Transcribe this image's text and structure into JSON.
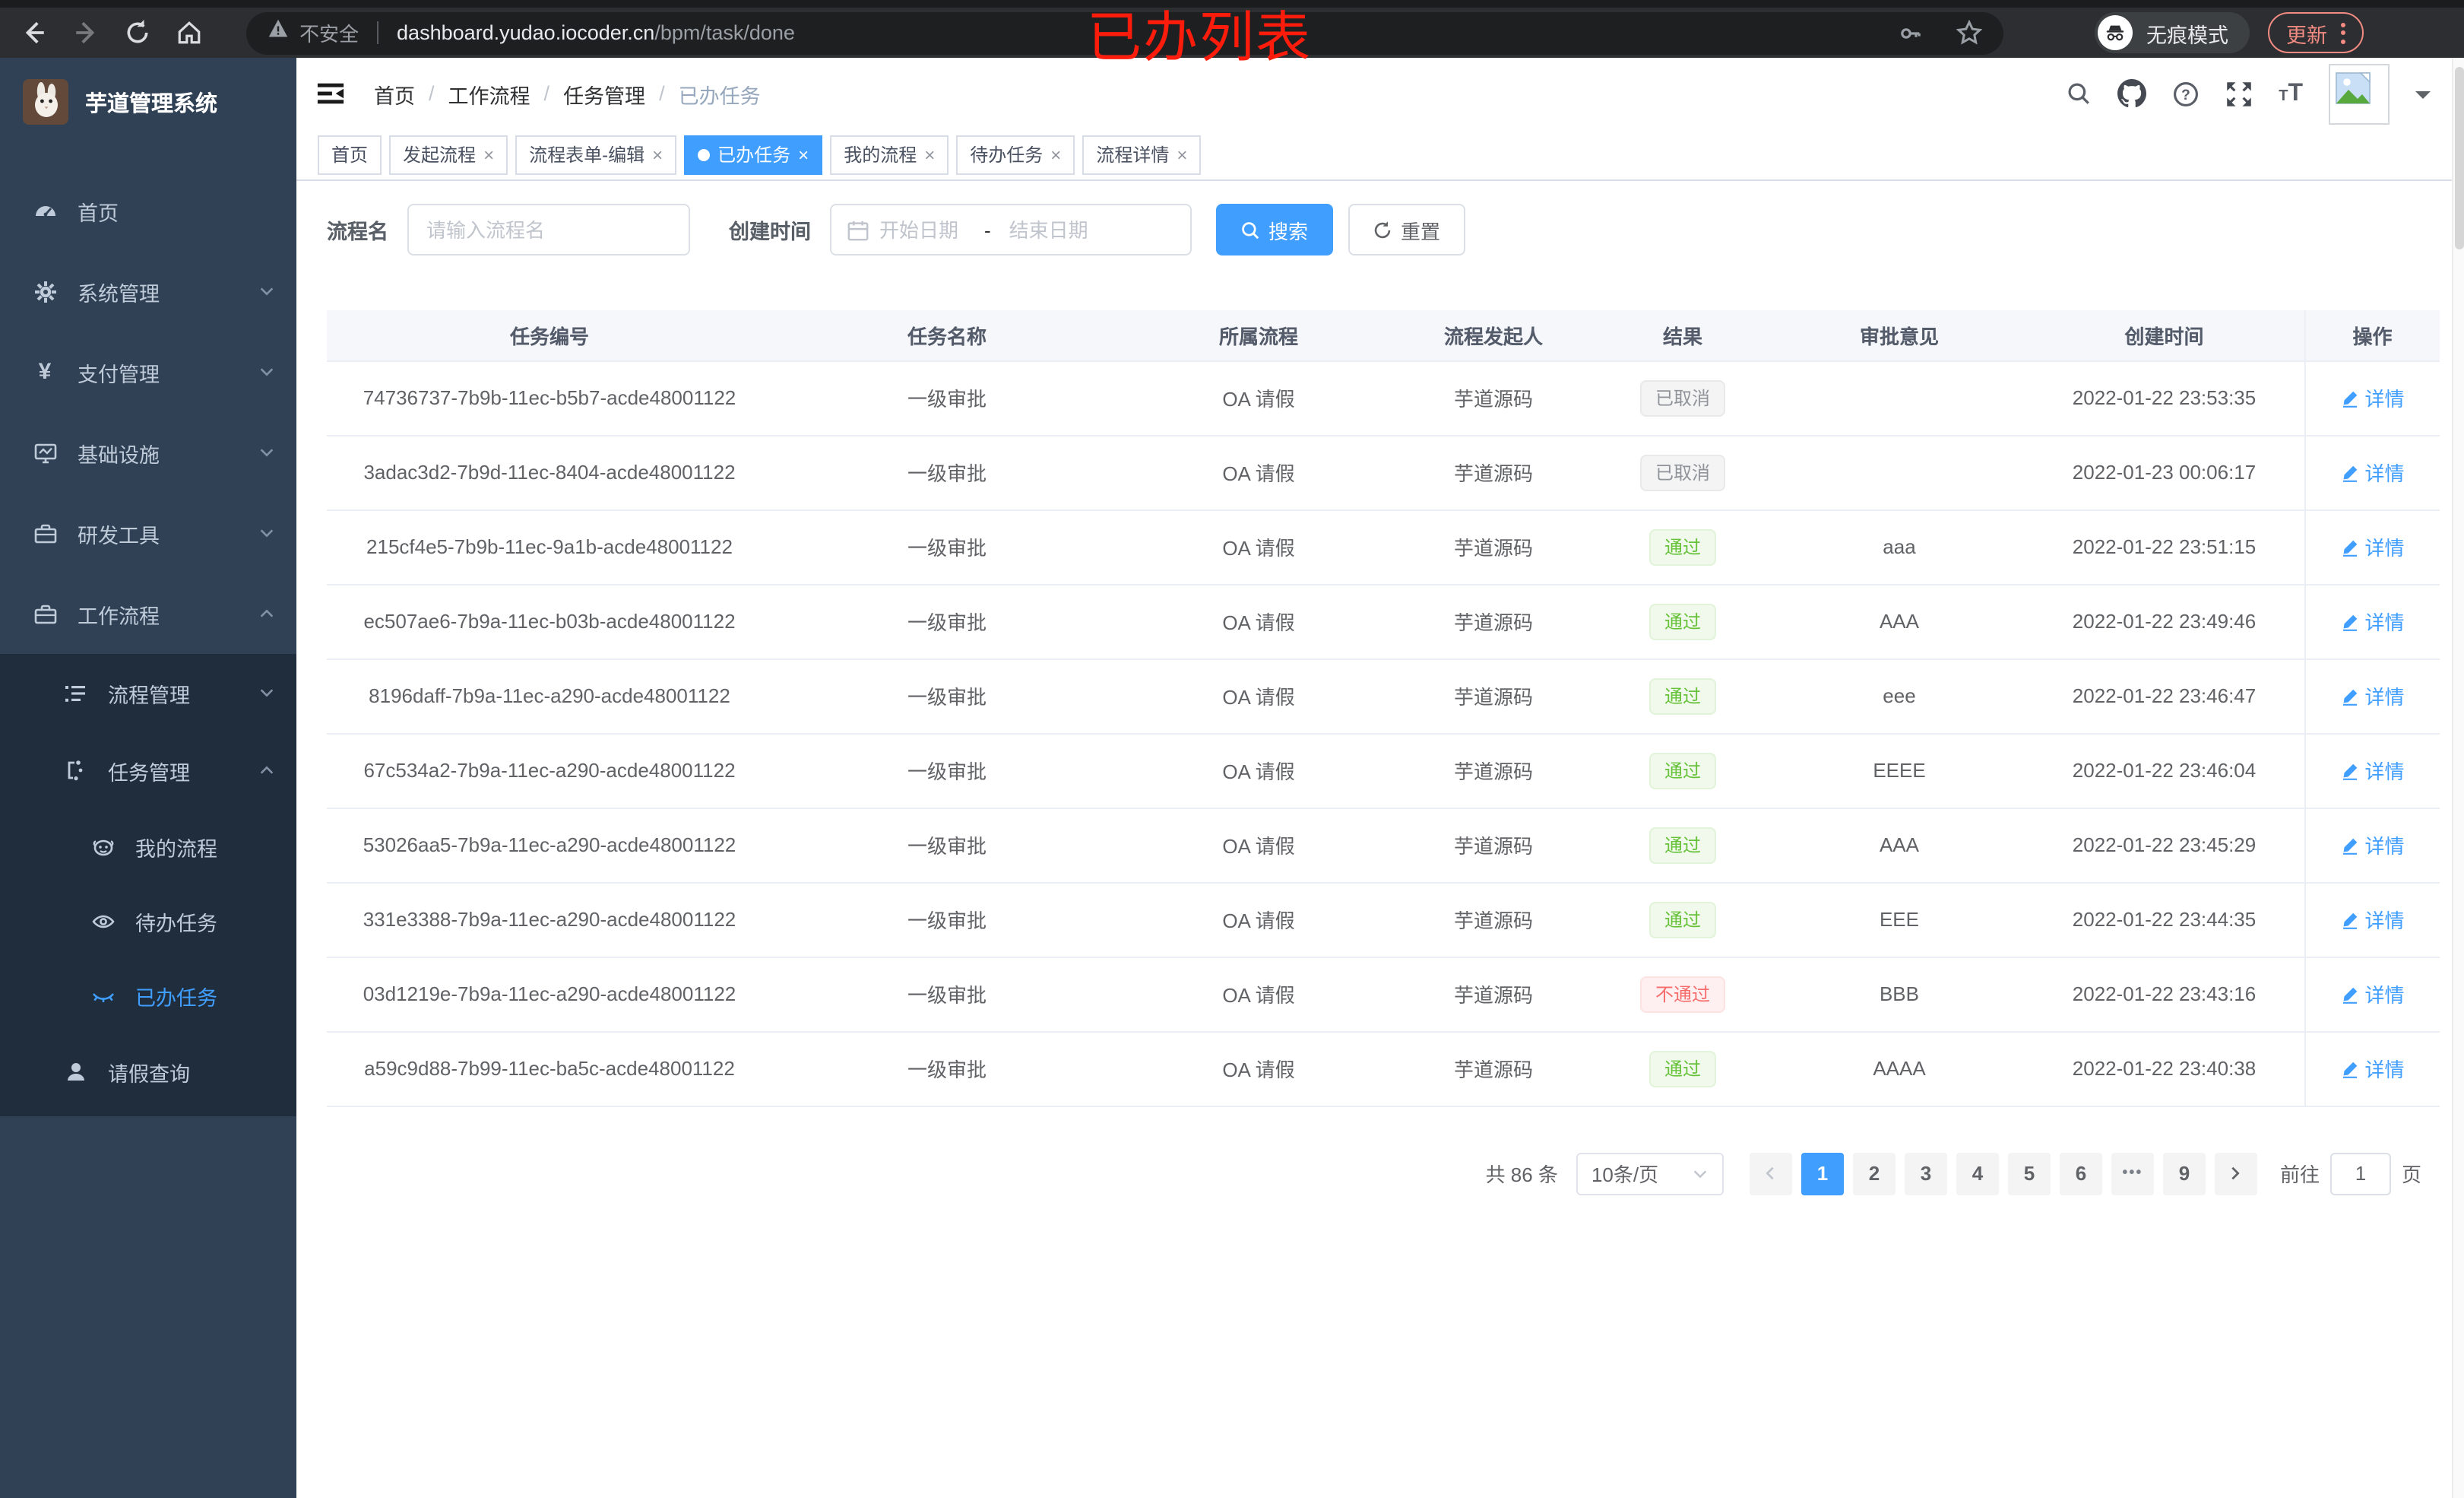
{
  "browser": {
    "security_label": "不安全",
    "url_host": "dashboard.yudao.iocoder.cn",
    "url_path": "/bpm/task/done",
    "incognito_label": "无痕模式",
    "update_label": "更新",
    "icons": [
      "back-icon",
      "forward-icon",
      "reload-icon",
      "home-icon",
      "warning-icon",
      "key-icon",
      "star-icon",
      "incognito-icon",
      "more-vert-icon"
    ]
  },
  "annotation": {
    "text": "已办列表",
    "color": "#fb1c0c"
  },
  "sidebar": {
    "title": "芋道管理系统",
    "logo_icon": "rabbit-logo",
    "menu": [
      {
        "label": "首页",
        "icon": "dashboard-icon"
      },
      {
        "label": "系统管理",
        "icon": "gear-icon",
        "chevron": "down"
      },
      {
        "label": "支付管理",
        "icon": "yen-icon",
        "chevron": "down"
      },
      {
        "label": "基础设施",
        "icon": "monitor-icon",
        "chevron": "down"
      },
      {
        "label": "研发工具",
        "icon": "toolbox-icon",
        "chevron": "down"
      },
      {
        "label": "工作流程",
        "icon": "toolbox-icon",
        "chevron": "up"
      }
    ],
    "submenu": [
      {
        "label": "流程管理",
        "icon": "tree-icon",
        "chevron": "down"
      },
      {
        "label": "任务管理",
        "icon": "flow-icon",
        "chevron": "up"
      },
      {
        "label": "我的流程",
        "icon": "robot-icon"
      },
      {
        "label": "待办任务",
        "icon": "eye-icon"
      },
      {
        "label": "已办任务",
        "icon": "eye-closed-icon",
        "active": true
      },
      {
        "label": "请假查询",
        "icon": "user-icon"
      }
    ]
  },
  "header": {
    "breadcrumb": [
      "首页",
      "工作流程",
      "任务管理",
      "已办任务"
    ],
    "separator": "/",
    "icons": [
      "fold-icon",
      "search-icon",
      "github-icon",
      "help-icon",
      "fullscreen-icon",
      "font-size-icon",
      "avatar-broken-image",
      "caret-down-icon"
    ]
  },
  "tags": [
    {
      "label": "首页",
      "closable": false,
      "active": false
    },
    {
      "label": "发起流程",
      "closable": true,
      "active": false
    },
    {
      "label": "流程表单-编辑",
      "closable": true,
      "active": false
    },
    {
      "label": "已办任务",
      "closable": true,
      "active": true
    },
    {
      "label": "我的流程",
      "closable": true,
      "active": false
    },
    {
      "label": "待办任务",
      "closable": true,
      "active": false
    },
    {
      "label": "流程详情",
      "closable": true,
      "active": false
    }
  ],
  "close_glyph": "×",
  "filter": {
    "name_label": "流程名",
    "name_placeholder": "请输入流程名",
    "time_label": "创建时间",
    "start_placeholder": "开始日期",
    "range_separator": "-",
    "end_placeholder": "结束日期",
    "search_label": "搜索",
    "reset_label": "重置"
  },
  "table": {
    "columns": [
      "任务编号",
      "任务名称",
      "所属流程",
      "流程发起人",
      "结果",
      "审批意见",
      "创建时间",
      "操作"
    ],
    "rows": [
      {
        "id": "74736737-7b9b-11ec-b5b7-acde48001122",
        "name": "一级审批",
        "process": "OA 请假",
        "starter": "芋道源码",
        "result": "已取消",
        "result_type": "info",
        "comment": "",
        "time": "2022-01-22 23:53:35",
        "action": "详情"
      },
      {
        "id": "3adac3d2-7b9d-11ec-8404-acde48001122",
        "name": "一级审批",
        "process": "OA 请假",
        "starter": "芋道源码",
        "result": "已取消",
        "result_type": "info",
        "comment": "",
        "time": "2022-01-23 00:06:17",
        "action": "详情"
      },
      {
        "id": "215cf4e5-7b9b-11ec-9a1b-acde48001122",
        "name": "一级审批",
        "process": "OA 请假",
        "starter": "芋道源码",
        "result": "通过",
        "result_type": "success",
        "comment": "aaa",
        "time": "2022-01-22 23:51:15",
        "action": "详情"
      },
      {
        "id": "ec507ae6-7b9a-11ec-b03b-acde48001122",
        "name": "一级审批",
        "process": "OA 请假",
        "starter": "芋道源码",
        "result": "通过",
        "result_type": "success",
        "comment": "AAA",
        "time": "2022-01-22 23:49:46",
        "action": "详情"
      },
      {
        "id": "8196daff-7b9a-11ec-a290-acde48001122",
        "name": "一级审批",
        "process": "OA 请假",
        "starter": "芋道源码",
        "result": "通过",
        "result_type": "success",
        "comment": "eee",
        "time": "2022-01-22 23:46:47",
        "action": "详情"
      },
      {
        "id": "67c534a2-7b9a-11ec-a290-acde48001122",
        "name": "一级审批",
        "process": "OA 请假",
        "starter": "芋道源码",
        "result": "通过",
        "result_type": "success",
        "comment": "EEEE",
        "time": "2022-01-22 23:46:04",
        "action": "详情"
      },
      {
        "id": "53026aa5-7b9a-11ec-a290-acde48001122",
        "name": "一级审批",
        "process": "OA 请假",
        "starter": "芋道源码",
        "result": "通过",
        "result_type": "success",
        "comment": "AAA",
        "time": "2022-01-22 23:45:29",
        "action": "详情"
      },
      {
        "id": "331e3388-7b9a-11ec-a290-acde48001122",
        "name": "一级审批",
        "process": "OA 请假",
        "starter": "芋道源码",
        "result": "通过",
        "result_type": "success",
        "comment": "EEE",
        "time": "2022-01-22 23:44:35",
        "action": "详情"
      },
      {
        "id": "03d1219e-7b9a-11ec-a290-acde48001122",
        "name": "一级审批",
        "process": "OA 请假",
        "starter": "芋道源码",
        "result": "不通过",
        "result_type": "danger",
        "comment": "BBB",
        "time": "2022-01-22 23:43:16",
        "action": "详情"
      },
      {
        "id": "a59c9d88-7b99-11ec-ba5c-acde48001122",
        "name": "一级审批",
        "process": "OA 请假",
        "starter": "芋道源码",
        "result": "通过",
        "result_type": "success",
        "comment": "AAAA",
        "time": "2022-01-22 23:40:38",
        "action": "详情"
      }
    ]
  },
  "pagination": {
    "total_label": "共 86 条",
    "page_size_label": "10条/页",
    "pages": [
      {
        "label": "1",
        "state": "active"
      },
      {
        "label": "2",
        "state": ""
      },
      {
        "label": "3",
        "state": ""
      },
      {
        "label": "4",
        "state": ""
      },
      {
        "label": "5",
        "state": ""
      },
      {
        "label": "6",
        "state": ""
      },
      {
        "label": "•••",
        "state": "more"
      },
      {
        "label": "9",
        "state": ""
      }
    ],
    "goto_label": "前往",
    "goto_value": "1",
    "unit_label": "页"
  },
  "colors": {
    "accent": "#409eff",
    "sidebar_bg": "#304156",
    "submenu_bg": "#1f2d3d",
    "success": "#67c23a",
    "danger": "#f56c6c",
    "info": "#909399",
    "annotation": "#fb1c0c"
  }
}
